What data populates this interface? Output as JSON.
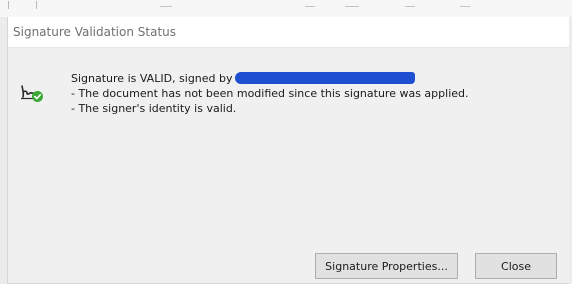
{
  "dialog": {
    "title": "Signature Validation Status"
  },
  "message": {
    "line1_prefix": "Signature is VALID, signed by",
    "line2": "- The document has not been modified since this signature was applied.",
    "line3": "- The signer's identity is valid.",
    "status_icon": "signature-valid-icon",
    "redaction_color": "#1f4fd1"
  },
  "buttons": {
    "signature_properties": "Signature Properties...",
    "close": "Close"
  },
  "colors": {
    "content_background": "#f0f0f0",
    "valid_check": "#3aa935"
  }
}
